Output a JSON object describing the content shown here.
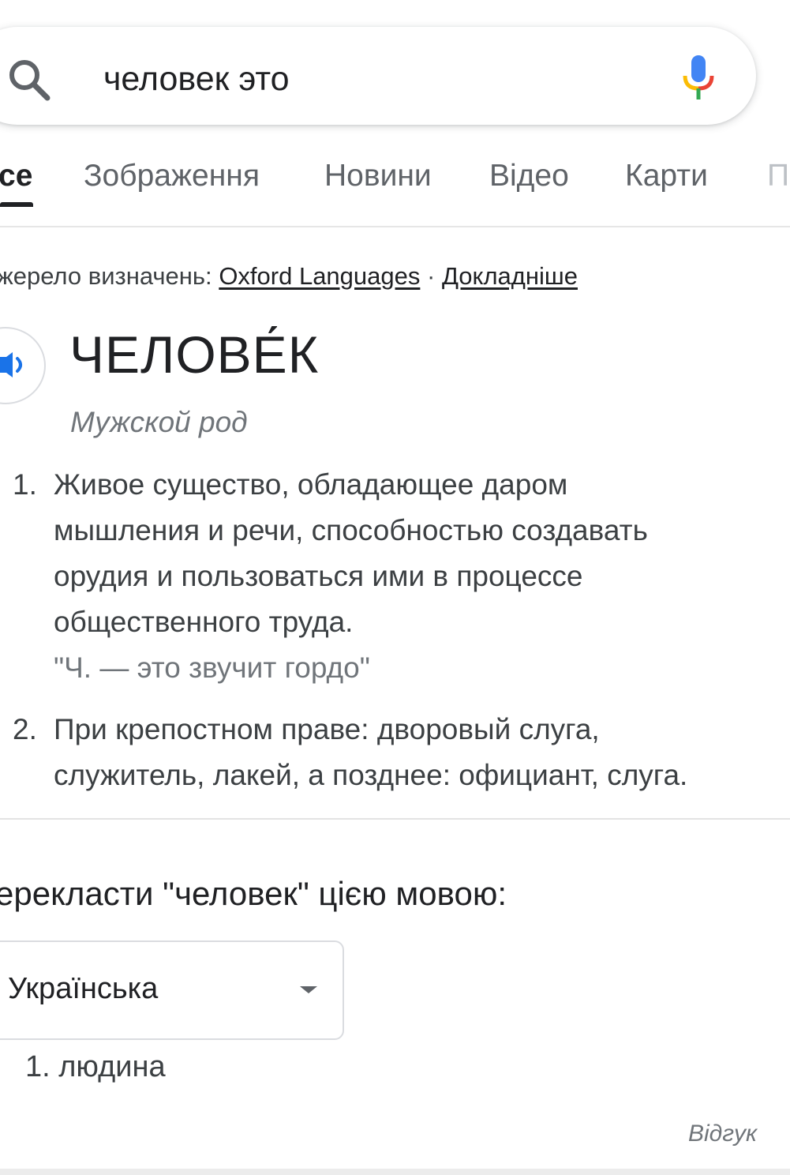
{
  "search": {
    "query": "человек это",
    "icon": "search-icon",
    "mic_icon": "mic-icon"
  },
  "tabs": [
    {
      "label": "се",
      "active": true
    },
    {
      "label": "Зображення",
      "active": false
    },
    {
      "label": "Новини",
      "active": false
    },
    {
      "label": "Відео",
      "active": false
    },
    {
      "label": "Карти",
      "active": false
    },
    {
      "label": "П",
      "active": false
    }
  ],
  "source": {
    "prefix": "жерело визначень:",
    "provider": "Oxford Languages",
    "separator": "·",
    "more": "Докладніше"
  },
  "entry": {
    "headword": "ЧЕЛОВЕ́К",
    "part_of_speech": "Мужской род",
    "definitions": [
      {
        "number": "1.",
        "lines": [
          "Живое существо, обладающее даром",
          "мышления и речи, способностью создавать",
          "орудия и пользоваться ими в процессе",
          "общественного труда."
        ],
        "example": "\"Ч. — это звучит гордо\""
      },
      {
        "number": "2.",
        "lines": [
          "При крепостном праве: дворовый слуга,",
          "служитель, лакей, а позднее: официант, слуга."
        ]
      }
    ]
  },
  "translate": {
    "heading": "ерекласти \"человек\" цією мовою:",
    "language": "Українська",
    "results": [
      "1. людина"
    ],
    "feedback": "Відгук"
  },
  "colors": {
    "text": "#202124",
    "secondary": "#5f6368",
    "muted": "#70757a",
    "blue": "#4285f4",
    "red": "#ea4335",
    "yellow": "#fbbc05",
    "green": "#34a853"
  }
}
